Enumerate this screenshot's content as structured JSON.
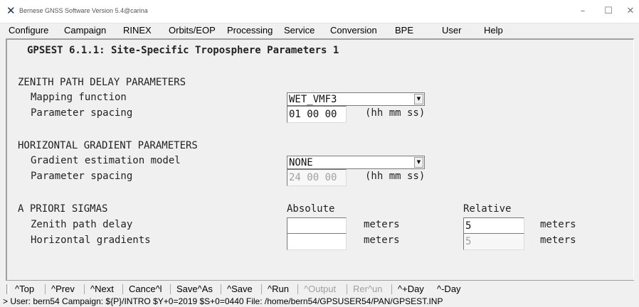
{
  "window": {
    "title": "Bernese GNSS Software Version 5.4@carina",
    "app_icon": "x-logo-icon",
    "controls": {
      "minimize": "–",
      "maximize": "☐",
      "close": "✕"
    }
  },
  "menu": [
    "Configure",
    "Campaign",
    "RINEX",
    "Orbits/EOP",
    "Processing",
    "Service",
    "Conversion",
    "BPE",
    "User",
    "Help"
  ],
  "panel": {
    "title": "GPSEST 6.1.1: Site-Specific Troposphere Parameters 1",
    "zenith": {
      "heading": "ZENITH PATH DELAY PARAMETERS",
      "mapping_label": "Mapping function",
      "mapping_value": "WET_VMF3",
      "spacing_label": "Parameter spacing",
      "spacing_value": "01 00 00",
      "spacing_unit": "(hh mm ss)"
    },
    "gradient": {
      "heading": "HORIZONTAL GRADIENT PARAMETERS",
      "model_label": "Gradient estimation model",
      "model_value": "NONE",
      "spacing_label": "Parameter spacing",
      "spacing_value": "24 00 00",
      "spacing_unit": "(hh mm ss)"
    },
    "sigmas": {
      "heading": "A PRIORI SIGMAS",
      "absolute_header": "Absolute",
      "relative_header": "Relative",
      "zenith_label": "Zenith path delay",
      "zenith_abs": "",
      "zenith_abs_unit": "meters",
      "zenith_rel": "5",
      "zenith_rel_unit": "meters",
      "gradients_label": "Horizontal gradients",
      "gradients_abs": "",
      "gradients_abs_unit": "meters",
      "gradients_rel": "5",
      "gradients_rel_unit": "meters"
    }
  },
  "toolbar": {
    "top": "^Top",
    "prev": "^Prev",
    "next": "^Next",
    "cancel": "Cance^l",
    "saveas": "Save^As",
    "save": "^Save",
    "run": "^Run",
    "output": "^Output",
    "rerun": "Rer^un",
    "plusday": "^+Day",
    "minusday": "^-Day"
  },
  "status": "> User: bern54  Campaign: ${P}/INTRO  $Y+0=2019  $S+0=0440  File: /home/bern54/GPSUSER54/PAN/GPSEST.INP",
  "colors": {
    "background": "#f0f0f0",
    "field_bg": "#ffffff",
    "disabled_text": "#a0a0a0",
    "text": "#222222"
  }
}
